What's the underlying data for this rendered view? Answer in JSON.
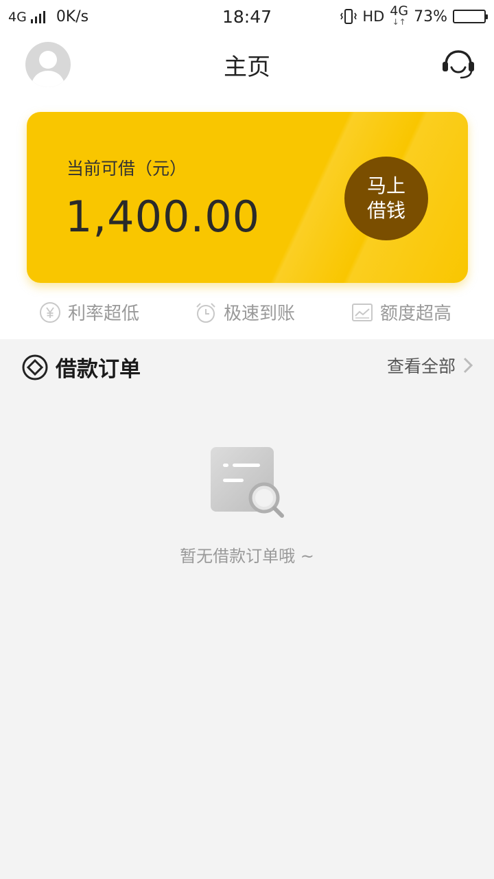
{
  "status_bar": {
    "network_left": "4G",
    "speed": "0K/s",
    "time": "18:47",
    "hd": "HD",
    "network_right": "4G",
    "battery": "73%",
    "battery_level": 0.73
  },
  "header": {
    "title": "主页"
  },
  "card": {
    "label": "当前可借（元）",
    "amount": "1,400.00",
    "button_line1": "马上",
    "button_line2": "借钱",
    "color": "#f9c600",
    "button_color": "#7a4e00"
  },
  "features": [
    {
      "label": "利率超低",
      "icon": "yen-icon"
    },
    {
      "label": "极速到账",
      "icon": "alarm-clock-icon"
    },
    {
      "label": "额度超高",
      "icon": "chart-icon"
    }
  ],
  "orders": {
    "title": "借款订单",
    "view_all": "查看全部",
    "empty_text": "暂无借款订单哦 ~"
  }
}
